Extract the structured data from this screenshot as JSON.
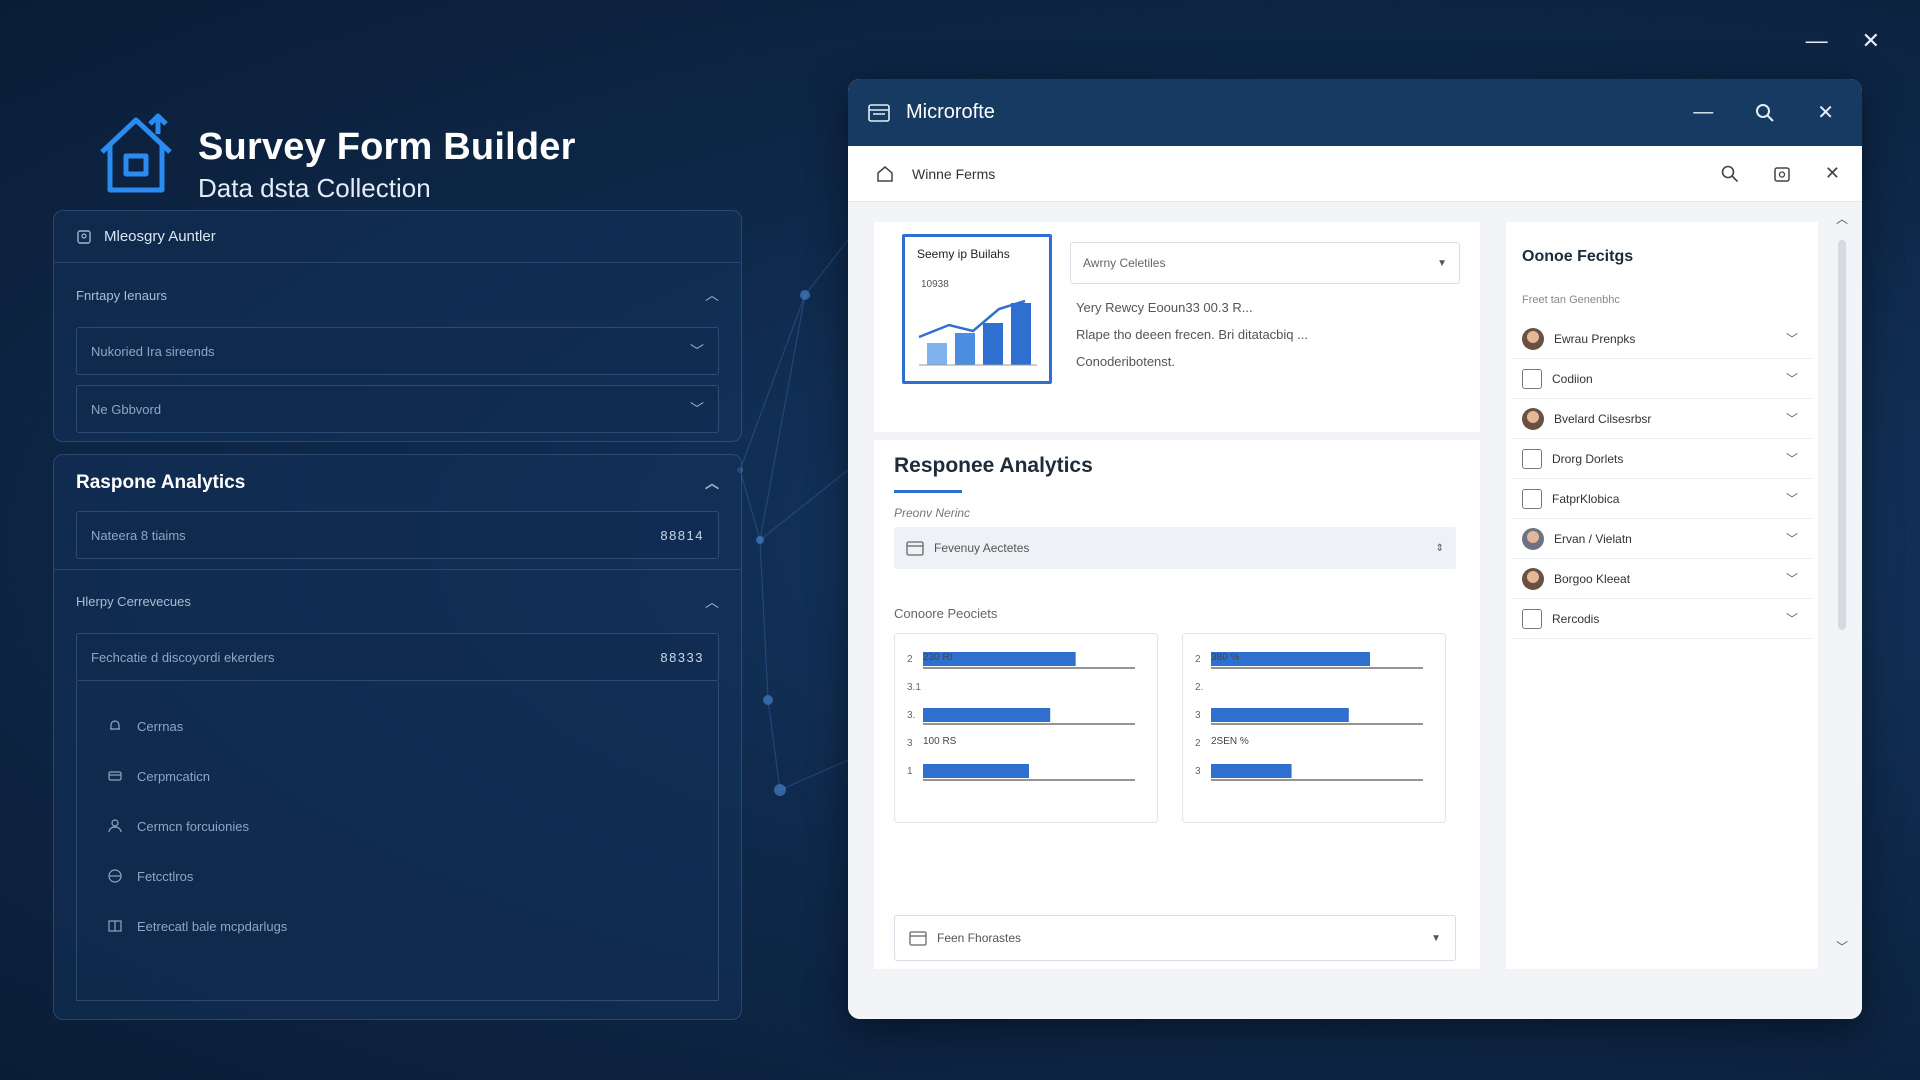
{
  "desktop": {
    "minimize_glyph": "—",
    "close_glyph": "✕"
  },
  "brand": {
    "title": "Survey Form Builder",
    "subtitle": "Data dsta Collection",
    "icon": "house-icon"
  },
  "left_panel_1": {
    "header": "Mleosgry Auntler",
    "section_label": "Fnrtapy Ienaurs",
    "fields": [
      {
        "placeholder": "Nukoried Ira sireends"
      },
      {
        "placeholder": "Ne Gbbvord"
      }
    ]
  },
  "left_panel_2": {
    "title": "Raspone Analytics",
    "metric_field": {
      "label": "Nateera 8 tiaims",
      "value": "88814"
    },
    "section_label": "Hlerpy Cerrevecues",
    "metric_field_2": {
      "label": "Fechcatie d discoyordi ekerders",
      "value": "88333"
    },
    "list": [
      {
        "label": "Cerrnas",
        "icon": "bell-icon"
      },
      {
        "label": "Cerpmcaticn",
        "icon": "card-icon"
      },
      {
        "label": "Cermcn forcuionies",
        "icon": "user-icon"
      },
      {
        "label": "Fetcctlros",
        "icon": "globe-icon"
      },
      {
        "label": "Eetrecatl bale mcpdarlugs",
        "icon": "grid-icon"
      }
    ]
  },
  "window": {
    "title": "Microrofte",
    "toolbar_label": "Winne Ferms",
    "main": {
      "thumbnail_title": "Seemy ip Builahs",
      "thumbnail_value": "10938",
      "select_top": "Awrny Celetiles",
      "desc_lines": [
        "Yery Rewcy Eooun33 00.3 R...",
        "Rlape tho deeen frecen. Bri ditatacbiq ...",
        "Conoderibotenst."
      ],
      "section_title": "Responee Analytics",
      "preview_label": "Preonv Nerinc",
      "filter_label": "Fevenuy Aectetes",
      "chart_section_label": "Conoore Peociets",
      "bottom_select": "Feen Fhorastes"
    },
    "side": {
      "title": "Oonoe Fecitgs",
      "subtitle": "Freet tan Genenbhc",
      "items": [
        {
          "label": "Ewrau Prenpks",
          "icon": "person-avatar-icon"
        },
        {
          "label": "Codiion",
          "icon": "person-outline-icon"
        },
        {
          "label": "Bvelard Cilsesrbsr",
          "icon": "person-avatar-icon"
        },
        {
          "label": "Drorg Dorlets",
          "icon": "document-icon"
        },
        {
          "label": "FatprKlobica",
          "icon": "tag-icon"
        },
        {
          "label": "Ervan / Vielatn",
          "icon": "group-icon"
        },
        {
          "label": "Borgoo Kleeat",
          "icon": "person-avatar-icon"
        },
        {
          "label": "Rercodis",
          "icon": "records-icon"
        }
      ]
    }
  },
  "chart_data": [
    {
      "type": "bar",
      "orientation": "horizontal",
      "annotations": [
        "230 RI",
        "100 RS"
      ],
      "categories": [
        "2",
        "3.1",
        "3.",
        "3",
        "1"
      ],
      "values": [
        72,
        0,
        60,
        0,
        50
      ],
      "xlim": [
        0,
        100
      ],
      "color": "#2f6fd0"
    },
    {
      "type": "bar",
      "orientation": "horizontal",
      "annotations": [
        "380 %",
        "2SEN %"
      ],
      "categories": [
        "2",
        "2.",
        "3",
        "2",
        "3"
      ],
      "values": [
        75,
        0,
        65,
        0,
        38
      ],
      "xlim": [
        0,
        100
      ],
      "color": "#2f6fd0"
    }
  ],
  "colors": {
    "accent": "#2f6fd0",
    "window_title_bar": "#173a63",
    "background": "#0f2a4d"
  }
}
